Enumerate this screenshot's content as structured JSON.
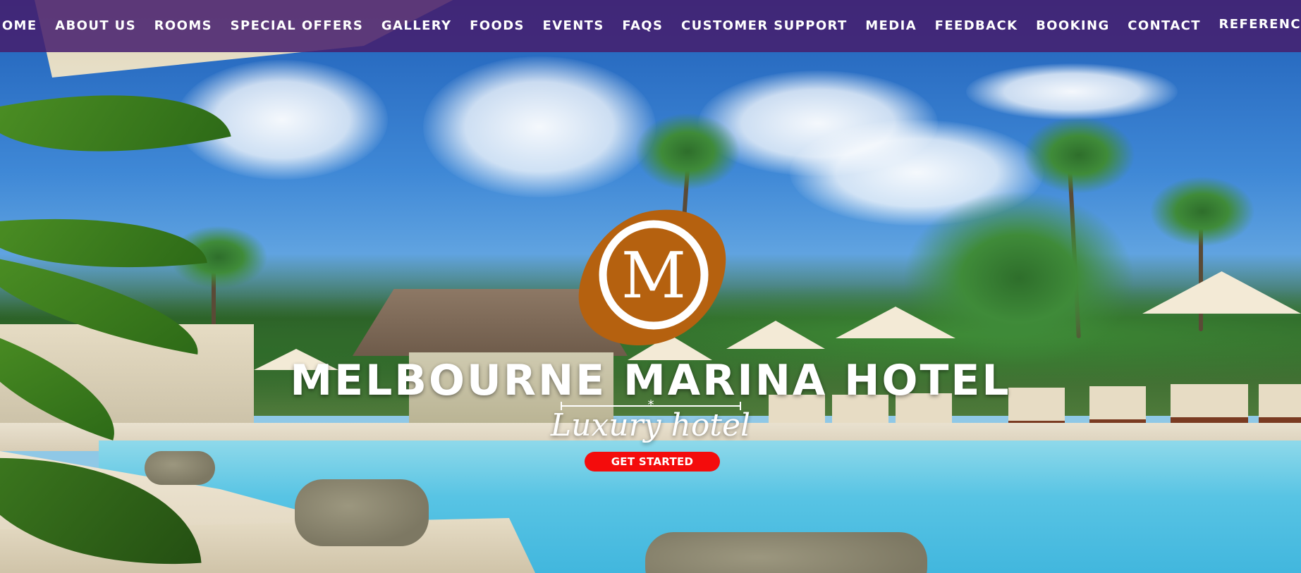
{
  "nav": {
    "items": [
      {
        "label": "HOME"
      },
      {
        "label": "ABOUT US"
      },
      {
        "label": "ROOMS"
      },
      {
        "label": "SPECIAL OFFERS"
      },
      {
        "label": "GALLERY"
      },
      {
        "label": "FOODS"
      },
      {
        "label": "EVENTS"
      },
      {
        "label": "FAQS"
      },
      {
        "label": "CUSTOMER SUPPORT"
      },
      {
        "label": "MEDIA"
      },
      {
        "label": "FEEDBACK"
      },
      {
        "label": "BOOKING"
      },
      {
        "label": "CONTACT"
      },
      {
        "label": "REFERENCE"
      }
    ]
  },
  "hero": {
    "logo_letter": "M",
    "title": "MELBOURNE MARINA HOTEL",
    "subtitle": "Luxury hotel",
    "cta_label": "GET STARTED",
    "background_image": "tropical-resort-pool-photo"
  },
  "colors": {
    "navbar_bg": "#461e6e",
    "logo_orange": "#b5610f",
    "cta_red": "#f40c0c",
    "text_white": "#ffffff"
  }
}
